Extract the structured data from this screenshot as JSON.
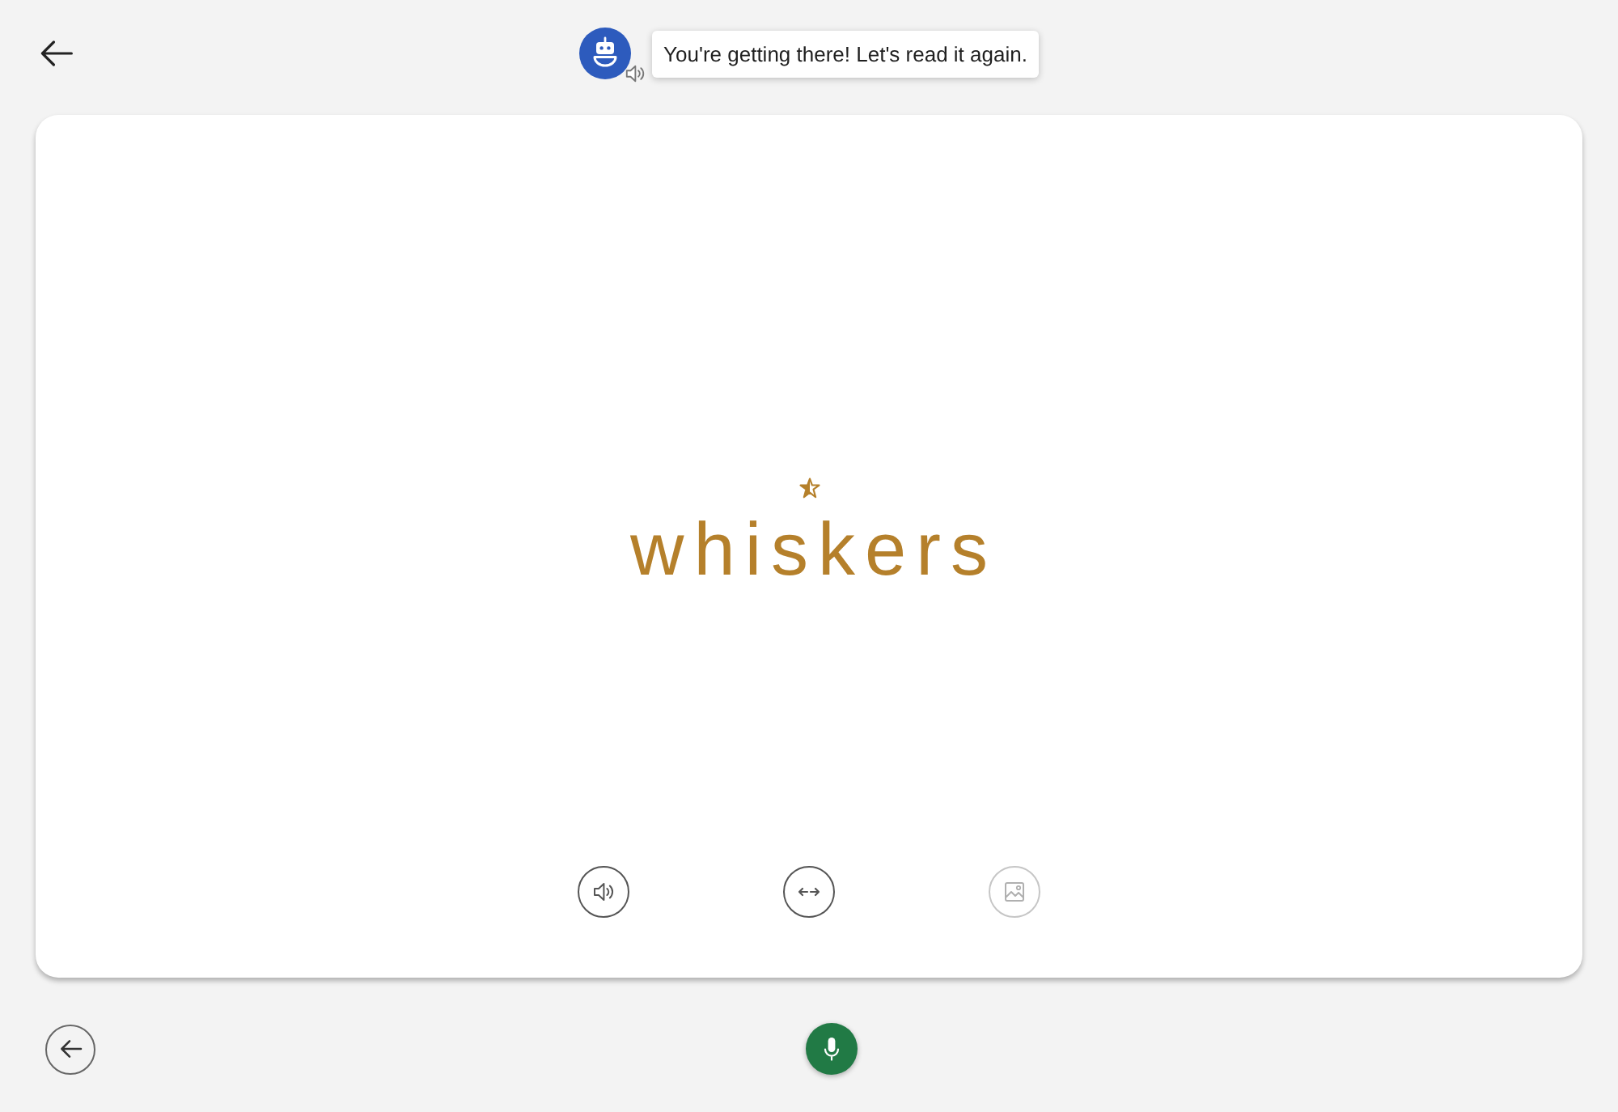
{
  "assistant": {
    "message": "You're getting there! Let's read it again."
  },
  "card": {
    "word": "whiskers",
    "actions": [
      {
        "kind": "speaker",
        "disabled": false
      },
      {
        "kind": "swap",
        "disabled": false
      },
      {
        "kind": "picture",
        "disabled": true
      }
    ]
  }
}
